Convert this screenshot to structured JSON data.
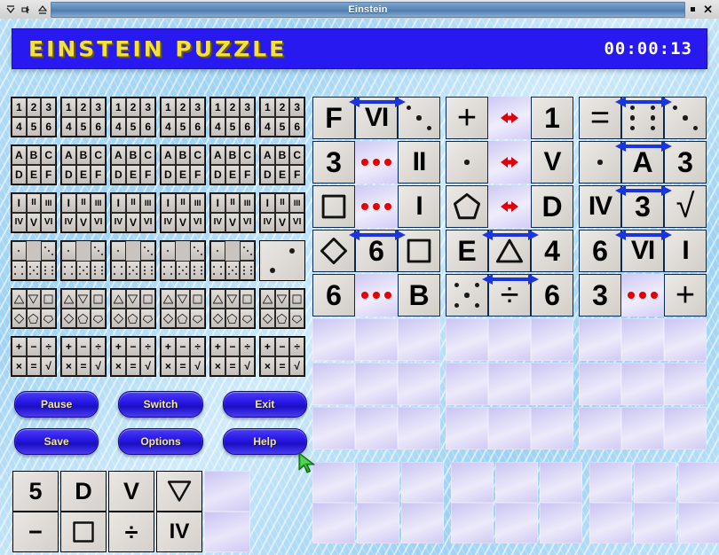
{
  "window": {
    "title": "Einstein",
    "titlebar_icons": [
      "shade-icon",
      "iconify-icon",
      "maximize-icon"
    ],
    "controls": [
      "restore-icon",
      "close-icon"
    ],
    "close_glyph": "✕"
  },
  "header": {
    "game_title": "EINSTEIN PUZZLE",
    "timer": "00:00:13",
    "band_color": "#2819f0",
    "title_color": "#f5e13c"
  },
  "board": {
    "rows": [
      {
        "id": "row-numbers",
        "type": "options",
        "cells": [
          {
            "options": [
              "1",
              "2",
              "3",
              "4",
              "5",
              "6"
            ]
          },
          {
            "options": [
              "1",
              "2",
              "3",
              "4",
              "5",
              "6"
            ]
          },
          {
            "options": [
              "1",
              "2",
              "3",
              "4",
              "5",
              "6"
            ]
          },
          {
            "options": [
              "1",
              "2",
              "3",
              "4",
              "5",
              "6"
            ]
          },
          {
            "options": [
              "1",
              "2",
              "3",
              "4",
              "5",
              "6"
            ]
          },
          {
            "options": [
              "1",
              "2",
              "3",
              "4",
              "5",
              "6"
            ]
          }
        ]
      },
      {
        "id": "row-letters",
        "type": "options",
        "cells": [
          {
            "options": [
              "A",
              "B",
              "C",
              "D",
              "E",
              "F"
            ]
          },
          {
            "options": [
              "A",
              "B",
              "C",
              "D",
              "E",
              "F"
            ]
          },
          {
            "options": [
              "A",
              "B",
              "C",
              "D",
              "E",
              "F"
            ]
          },
          {
            "options": [
              "A",
              "B",
              "C",
              "D",
              "E",
              "F"
            ]
          },
          {
            "options": [
              "A",
              "B",
              "C",
              "D",
              "E",
              "F"
            ]
          },
          {
            "options": [
              "A",
              "B",
              "C",
              "D",
              "E",
              "F"
            ]
          }
        ]
      },
      {
        "id": "row-roman",
        "type": "options",
        "cells": [
          {
            "options": [
              "I",
              "II",
              "III",
              "IV",
              "V",
              "VI"
            ]
          },
          {
            "options": [
              "I",
              "II",
              "III",
              "IV",
              "V",
              "VI"
            ]
          },
          {
            "options": [
              "I",
              "II",
              "III",
              "IV",
              "V",
              "VI"
            ]
          },
          {
            "options": [
              "I",
              "II",
              "III",
              "IV",
              "V",
              "VI"
            ]
          },
          {
            "options": [
              "I",
              "II",
              "III",
              "IV",
              "V",
              "VI"
            ]
          },
          {
            "options": [
              "I",
              "II",
              "III",
              "IV",
              "V",
              "VI"
            ]
          }
        ]
      },
      {
        "id": "row-dice",
        "type": "dice",
        "cells": [
          {
            "options": [
              1,
              0,
              3,
              4,
              5,
              6
            ]
          },
          {
            "options": [
              1,
              0,
              3,
              4,
              5,
              6
            ]
          },
          {
            "options": [
              1,
              0,
              3,
              4,
              5,
              6
            ]
          },
          {
            "options": [
              1,
              0,
              3,
              4,
              5,
              6
            ]
          },
          {
            "options": [
              1,
              0,
              3,
              4,
              5,
              6
            ]
          },
          {
            "solved": 2
          }
        ]
      },
      {
        "id": "row-shapes",
        "type": "shapes",
        "cells": [
          {
            "options": [
              "triangle-up",
              "triangle-down",
              "square",
              "diamond",
              "pentagon",
              "hexagon"
            ]
          },
          {
            "options": [
              "triangle-up",
              "triangle-down",
              "square",
              "diamond",
              "pentagon",
              "hexagon"
            ]
          },
          {
            "options": [
              "triangle-up",
              "triangle-down",
              "square",
              "diamond",
              "pentagon",
              "hexagon"
            ]
          },
          {
            "options": [
              "triangle-up",
              "triangle-down",
              "square",
              "diamond",
              "pentagon",
              "hexagon"
            ]
          },
          {
            "options": [
              "triangle-up",
              "triangle-down",
              "square",
              "diamond",
              "pentagon",
              "hexagon"
            ]
          },
          {
            "options": [
              "triangle-up",
              "triangle-down",
              "square",
              "diamond",
              "pentagon",
              "hexagon"
            ]
          }
        ]
      },
      {
        "id": "row-math",
        "type": "options",
        "cells": [
          {
            "options": [
              "+",
              "−",
              "÷",
              "×",
              "=",
              "√"
            ]
          },
          {
            "options": [
              "+",
              "−",
              "÷",
              "×",
              "=",
              "√"
            ]
          },
          {
            "options": [
              "+",
              "−",
              "÷",
              "×",
              "=",
              "√"
            ]
          },
          {
            "options": [
              "+",
              "−",
              "÷",
              "×",
              "=",
              "√"
            ]
          },
          {
            "options": [
              "+",
              "−",
              "÷",
              "×",
              "=",
              "√"
            ]
          },
          {
            "options": [
              "+",
              "−",
              "÷",
              "×",
              "=",
              "√"
            ]
          }
        ]
      }
    ]
  },
  "buttons": {
    "row1": [
      {
        "name": "pause-button",
        "label": "Pause"
      },
      {
        "name": "switch-button",
        "label": "Switch"
      },
      {
        "name": "exit-button",
        "label": "Exit"
      }
    ],
    "row2": [
      {
        "name": "save-button",
        "label": "Save"
      },
      {
        "name": "options-button",
        "label": "Options"
      },
      {
        "name": "help-button",
        "label": "Help"
      }
    ]
  },
  "tray": {
    "columns": [
      {
        "top": "5",
        "bottom": "−",
        "top_kind": "text",
        "bottom_kind": "text"
      },
      {
        "top": "D",
        "bottom": "square",
        "top_kind": "text",
        "bottom_kind": "shape"
      },
      {
        "top": "V",
        "bottom": "÷",
        "top_kind": "text",
        "bottom_kind": "text"
      },
      {
        "top": "triangle-down",
        "bottom": "IV",
        "top_kind": "shape",
        "bottom_kind": "text"
      }
    ],
    "empty_columns": 1
  },
  "clues": {
    "rows": [
      [
        {
          "kind": "near",
          "slots": [
            {
              "type": "text",
              "value": "F"
            },
            {
              "type": "text",
              "value": "VI"
            },
            {
              "type": "dice",
              "value": 3
            }
          ]
        },
        {
          "kind": "between-sep",
          "slots": [
            {
              "type": "text",
              "value": "+"
            },
            {
              "type": "arrow",
              "value": "red-double-arrow"
            },
            {
              "type": "text",
              "value": "1"
            }
          ]
        },
        {
          "kind": "near",
          "slots": [
            {
              "type": "text",
              "value": "="
            },
            {
              "type": "dice",
              "value": 6
            },
            {
              "type": "dice",
              "value": 3
            }
          ]
        }
      ],
      [
        {
          "kind": "not-near",
          "slots": [
            {
              "type": "text",
              "value": "3"
            },
            {
              "type": "dots",
              "value": "red-dots"
            },
            {
              "type": "text",
              "value": "II"
            }
          ]
        },
        {
          "kind": "between-sep",
          "slots": [
            {
              "type": "dice",
              "value": 1
            },
            {
              "type": "arrow",
              "value": "red-double-arrow"
            },
            {
              "type": "text",
              "value": "V"
            }
          ]
        },
        {
          "kind": "near",
          "slots": [
            {
              "type": "dice",
              "value": 1
            },
            {
              "type": "text",
              "value": "A"
            },
            {
              "type": "text",
              "value": "3"
            }
          ]
        }
      ],
      [
        {
          "kind": "not-near",
          "slots": [
            {
              "type": "shape",
              "value": "square"
            },
            {
              "type": "dots",
              "value": "red-dots"
            },
            {
              "type": "text",
              "value": "I"
            }
          ]
        },
        {
          "kind": "between-sep",
          "slots": [
            {
              "type": "shape",
              "value": "pentagon"
            },
            {
              "type": "arrow",
              "value": "red-double-arrow"
            },
            {
              "type": "text",
              "value": "D"
            }
          ]
        },
        {
          "kind": "near",
          "slots": [
            {
              "type": "text",
              "value": "IV"
            },
            {
              "type": "text",
              "value": "3"
            },
            {
              "type": "text",
              "value": "√"
            }
          ]
        }
      ],
      [
        {
          "kind": "near",
          "slots": [
            {
              "type": "shape",
              "value": "diamond"
            },
            {
              "type": "text",
              "value": "6"
            },
            {
              "type": "shape",
              "value": "square"
            }
          ]
        },
        {
          "kind": "near",
          "slots": [
            {
              "type": "text",
              "value": "E"
            },
            {
              "type": "shape",
              "value": "triangle-up"
            },
            {
              "type": "text",
              "value": "4"
            }
          ]
        },
        {
          "kind": "near",
          "slots": [
            {
              "type": "text",
              "value": "6"
            },
            {
              "type": "text",
              "value": "VI"
            },
            {
              "type": "text",
              "value": "I"
            }
          ]
        }
      ],
      [
        {
          "kind": "not-near",
          "slots": [
            {
              "type": "text",
              "value": "6"
            },
            {
              "type": "dots",
              "value": "red-dots"
            },
            {
              "type": "text",
              "value": "B"
            }
          ]
        },
        {
          "kind": "near",
          "slots": [
            {
              "type": "dice",
              "value": 5
            },
            {
              "type": "text",
              "value": "÷"
            },
            {
              "type": "text",
              "value": "6"
            }
          ]
        },
        {
          "kind": "not-near",
          "slots": [
            {
              "type": "text",
              "value": "3"
            },
            {
              "type": "dots",
              "value": "red-dots"
            },
            {
              "type": "text",
              "value": "+"
            }
          ]
        }
      ]
    ],
    "empty_rows": 3,
    "empty_cols_per_row": 9,
    "vertical_empty": {
      "columns": 9,
      "rows": 2
    },
    "arrow_color": "#1a34e0",
    "dot_color": "#e60000"
  },
  "cursor": {
    "name": "mouse-cursor",
    "color": "#1faa1f"
  }
}
